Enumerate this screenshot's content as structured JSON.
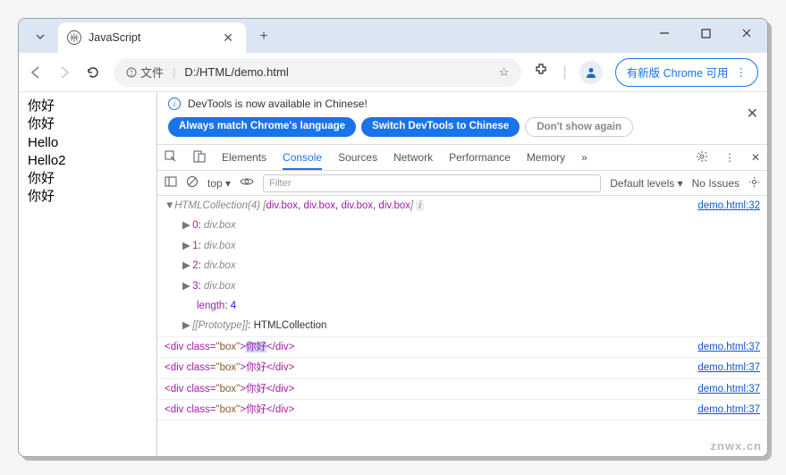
{
  "browser": {
    "tab_title": "JavaScript",
    "url": "D:/HTML/demo.html",
    "file_label": "文件",
    "update_text": "有新版 Chrome 可用"
  },
  "page_content": [
    "你好",
    "你好",
    "Hello",
    "Hello2",
    "你好",
    "你好"
  ],
  "devtools": {
    "banner_text": "DevTools is now available in Chinese!",
    "btn_match": "Always match Chrome's language",
    "btn_switch": "Switch DevTools to Chinese",
    "btn_dont": "Don't show again",
    "tabs": [
      "Elements",
      "Console",
      "Sources",
      "Network",
      "Performance",
      "Memory"
    ],
    "active_tab": "Console",
    "console_toolbar": {
      "context": "top",
      "filter_placeholder": "Filter",
      "levels": "Default levels",
      "issues": "No Issues"
    },
    "collection": {
      "header_prefix": "HTMLCollection(4)",
      "items_preview": [
        "div.box",
        "div.box",
        "div.box",
        "div.box"
      ],
      "link": "demo.html:32",
      "entries": [
        {
          "idx": "0",
          "val": "div.box"
        },
        {
          "idx": "1",
          "val": "div.box"
        },
        {
          "idx": "2",
          "val": "div.box"
        },
        {
          "idx": "3",
          "val": "div.box"
        }
      ],
      "length_label": "length",
      "length_value": "4",
      "proto_label": "[[Prototype]]",
      "proto_value": "HTMLCollection"
    },
    "log_rows": [
      {
        "html": "<div class=\"box\">你好</div>",
        "link": "demo.html:37"
      },
      {
        "html": "<div class=\"box\">你好</div>",
        "link": "demo.html:37"
      },
      {
        "html": "<div class=\"box\">你好</div>",
        "link": "demo.html:37"
      },
      {
        "html": "<div class=\"box\">你好</div>",
        "link": "demo.html:37"
      }
    ]
  },
  "watermark": "znwx.cn"
}
